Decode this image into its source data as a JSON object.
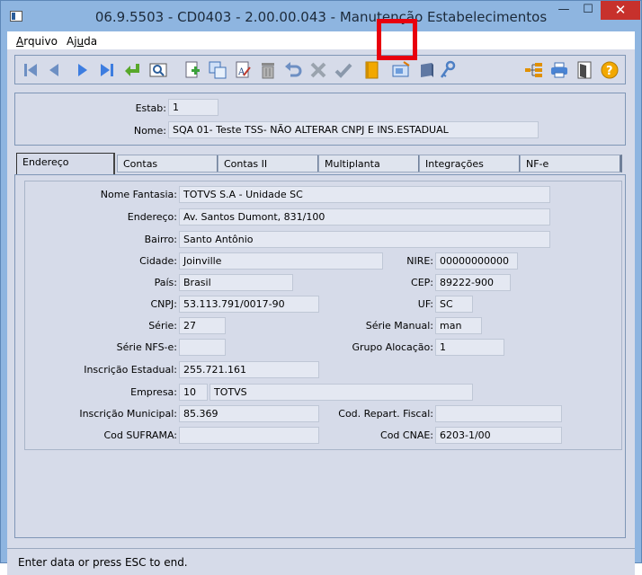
{
  "window": {
    "title": "06.9.5503 - CD0403 - 2.00.00.043 - Manutenção Estabelecimentos",
    "minimize": "—",
    "maximize": "☐",
    "close": "✕"
  },
  "menu": {
    "arquivo": "Arquivo",
    "ajuda": "Ajuda"
  },
  "toolbar_icons": [
    "first-icon",
    "prev-icon",
    "next-icon",
    "last-icon",
    "goto-icon",
    "zoom-icon",
    "new-icon",
    "copy-icon",
    "edit-icon",
    "delete-icon",
    "undo-icon",
    "cancel-icon",
    "save-icon",
    "folder-icon",
    "monitor-icon",
    "disk-icon",
    "key-icon",
    "tree-icon",
    "print-icon",
    "exit-icon",
    "help-icon"
  ],
  "header": {
    "estab_label": "Estab:",
    "estab_value": "1",
    "nome_label": "Nome:",
    "nome_value": "SQA 01- Teste TSS-  NÃO ALTERAR CNPJ E INS.ESTADUAL"
  },
  "tabs": [
    "Endereço",
    "Contas",
    "Contas II",
    "Multiplanta",
    "Integrações",
    "NF-e"
  ],
  "fields": {
    "nome_fantasia": {
      "label": "Nome Fantasia:",
      "value": "TOTVS S.A - Unidade SC"
    },
    "endereco": {
      "label": "Endereço:",
      "value": "Av. Santos Dumont, 831/100"
    },
    "bairro": {
      "label": "Bairro:",
      "value": "Santo Antônio"
    },
    "cidade": {
      "label": "Cidade:",
      "value": "Joinville"
    },
    "nire": {
      "label": "NIRE:",
      "value": "00000000000"
    },
    "pais": {
      "label": "País:",
      "value": "Brasil"
    },
    "cep": {
      "label": "CEP:",
      "value": "89222-900"
    },
    "cnpj": {
      "label": "CNPJ:",
      "value": "53.113.791/0017-90"
    },
    "uf": {
      "label": "UF:",
      "value": "SC"
    },
    "serie": {
      "label": "Série:",
      "value": "27"
    },
    "serie_manual": {
      "label": "Série Manual:",
      "value": "man"
    },
    "serie_nfse": {
      "label": "Série NFS-e:",
      "value": ""
    },
    "grupo_alocacao": {
      "label": "Grupo Alocação:",
      "value": "1"
    },
    "inscricao_estadual": {
      "label": "Inscrição Estadual:",
      "value": "255.721.161"
    },
    "empresa": {
      "label": "Empresa:",
      "code": "10",
      "name": "TOTVS"
    },
    "inscricao_municipal": {
      "label": "Inscrição Municipal:",
      "value": "85.369"
    },
    "cod_repart_fiscal": {
      "label": "Cod. Repart. Fiscal:",
      "value": ""
    },
    "cod_suframa": {
      "label": "Cod SUFRAMA:",
      "value": ""
    },
    "cod_cnae": {
      "label": "Cod CNAE:",
      "value": "6203-1/00"
    }
  },
  "status": "Enter data or press ESC to end.",
  "colors": {
    "window_frame": "#8eb5e0",
    "panel": "#d6dbe9",
    "field": "#e4e8f2",
    "close": "#c7312c",
    "highlight": "#e8000e"
  }
}
